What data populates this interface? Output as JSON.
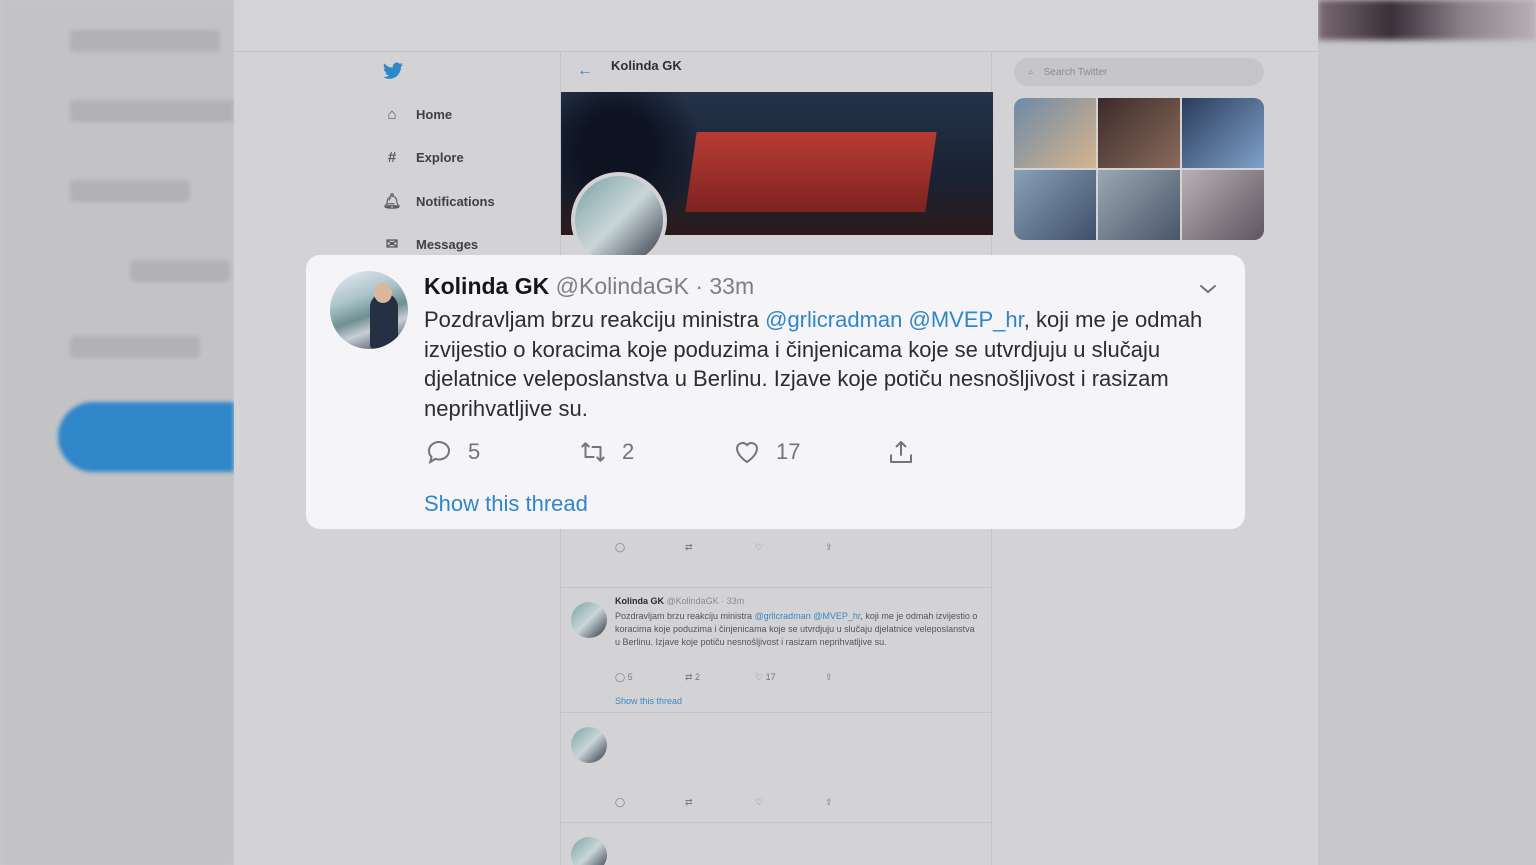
{
  "background": {
    "nav_items": [
      {
        "label": "Home",
        "icon": "home-icon"
      },
      {
        "label": "Explore",
        "icon": "hashtag-icon"
      },
      {
        "label": "Notifications",
        "icon": "bell-icon"
      },
      {
        "label": "Messages",
        "icon": "envelope-icon"
      }
    ],
    "profile_name": "Kolinda GK",
    "search_placeholder": "Search Twitter",
    "tweets": [
      {
        "name": "Kolinda GK",
        "handle": "@KolindaGK · 33m",
        "text_plain": "Pozdravljam brzu reakciju ministra ",
        "m1": "@grlicradman",
        "m2": "@MVEP_hr",
        "text_rest": ", koji me je odmah izvijestio o koracima koje poduzima i činjenicama koje se utvrdjuju u slučaju djelatnice veleposlanstva u Berlinu. Izjave koje potiču nesnošljivost i rasizam neprihvatljive su.",
        "reply": "5",
        "retweet": "2",
        "like": "17",
        "show_thread": "Show this thread"
      }
    ]
  },
  "card": {
    "name": "Kolinda GK",
    "handle": "@KolindaGK · 33m",
    "text_before": "Pozdravljam brzu reakciju ministra ",
    "mention_1": "@grlicradman",
    "mention_2": "@MVEP_hr",
    "text_after": ", koji me je odmah izvijestio o koracima koje poduzima i činjenicama koje se utvrdjuju u slučaju djelatnice veleposlanstva u Berlinu. Izjave koje potiču nesnošljivost i rasizam neprihvatljive su.",
    "reply_count": "5",
    "retweet_count": "2",
    "like_count": "17",
    "show_thread": "Show this thread"
  },
  "colors": {
    "accent": "#2f86c8",
    "card_bg": "#f5f5f7",
    "dim_bg": "#d3d3d5"
  }
}
